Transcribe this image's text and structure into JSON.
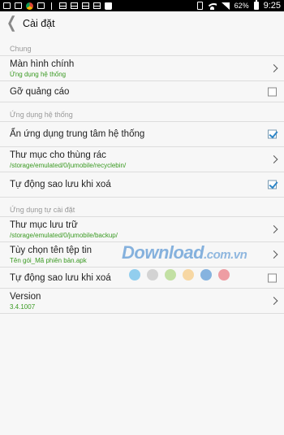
{
  "status": {
    "battery_pct": "62%",
    "time": "9:25"
  },
  "app": {
    "title": "Cài đặt"
  },
  "sections": {
    "general": {
      "header": "Chung",
      "main_screen": {
        "label": "Màn hình chính",
        "value": "Ứng dụng hệ thống"
      },
      "remove_ads": {
        "label": "Gỡ quảng cáo",
        "checked": false
      }
    },
    "system_apps": {
      "header": "Ứng dụng hệ thống",
      "hide_system_center": {
        "label": "Ẩn ứng dụng trung tâm hệ thống",
        "checked": true
      },
      "recycle_folder": {
        "label": "Thư mục cho thùng rác",
        "value": "/storage/emulated/0/jumobile/recyclebin/"
      },
      "auto_backup": {
        "label": "Tự động sao lưu khi xoá",
        "checked": true
      }
    },
    "user_apps": {
      "header": "Ứng dụng tự cài đặt",
      "storage_folder": {
        "label": "Thư mục lưu trữ",
        "value": "/storage/emulated/0/jumobile/backup/"
      },
      "file_name_option": {
        "label": "Tùy chọn tên tệp tin",
        "value": "Tên gói_Mã phiên bản.apk"
      },
      "auto_backup": {
        "label": "Tự động sao lưu khi xoá",
        "checked": false
      },
      "version": {
        "label": "Version",
        "value": "3.4.1007"
      }
    }
  },
  "watermark": {
    "main": "Download",
    "suffix": ".com.vn"
  },
  "colors": {
    "accent_green": "#3a9a22",
    "check_blue": "#2d86c8"
  }
}
